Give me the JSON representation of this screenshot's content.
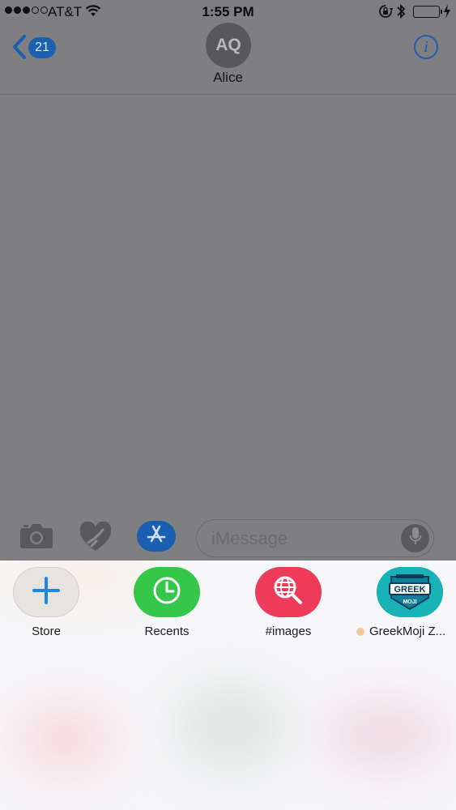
{
  "status_bar": {
    "carrier": "AT&T",
    "time": "1:55 PM",
    "battery_color": "#4cd964"
  },
  "header": {
    "back_badge": "21",
    "avatar_initials": "AQ",
    "contact_name": "Alice",
    "info_glyph": "i"
  },
  "compose": {
    "placeholder": "iMessage",
    "icons": [
      "camera-icon",
      "digital-touch-heart-icon",
      "app-store-icon",
      "microphone-icon"
    ]
  },
  "drawer": {
    "apps": [
      {
        "label": "Store",
        "icon": "plus-icon"
      },
      {
        "label": "Recents",
        "icon": "clock-icon"
      },
      {
        "label": "#images",
        "icon": "globe-search-icon"
      },
      {
        "label": "GreekMoji Z...",
        "icon": "greekmoji-logo-icon"
      }
    ],
    "greekmoji_logo_text": "GREEK",
    "greekmoji_logo_sub": "MOJI"
  },
  "colors": {
    "accent": "#1a5fb0",
    "dim_overlay": "#7f7e81",
    "recents_green": "#35c74a",
    "images_red": "#ef3b5a",
    "greekmoji_teal": "#19b3b7"
  }
}
